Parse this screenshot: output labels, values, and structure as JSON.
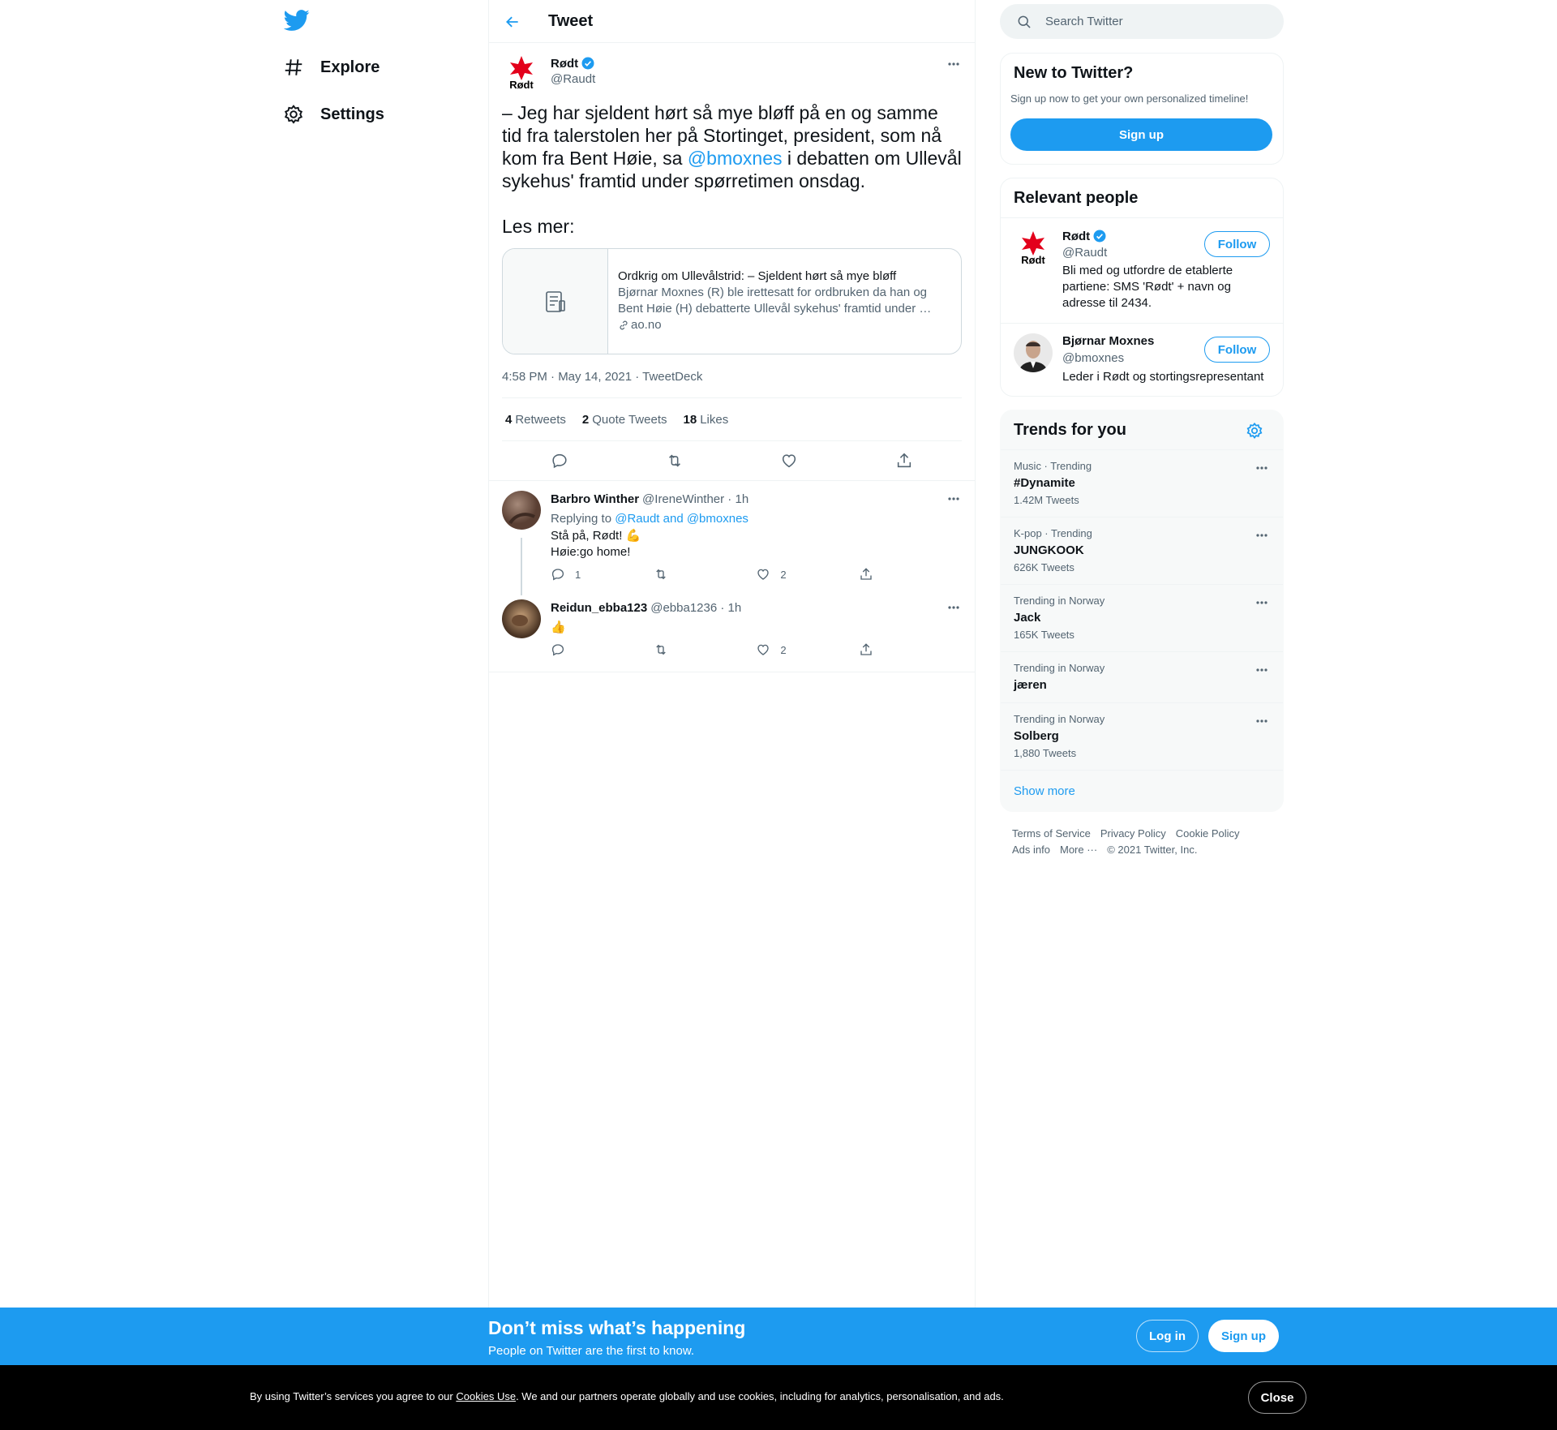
{
  "colors": {
    "accent": "#1d9bf0",
    "text": "#0f1419",
    "muted": "#536471",
    "border": "#eff3f4",
    "cookie_bg": "#000000"
  },
  "nav": {
    "logo_icon": "twitter-bird-icon",
    "items": [
      {
        "label": "Explore",
        "icon": "hashtag-icon"
      },
      {
        "label": "Settings",
        "icon": "gear-icon"
      }
    ]
  },
  "header": {
    "title": "Tweet",
    "back_icon": "arrow-left-icon"
  },
  "main_tweet": {
    "author_name": "Rødt",
    "author_handle": "@Raudt",
    "avatar_text": "Rødt",
    "text_before": "– Jeg har sjeldent hørt så mye bløff på en og samme tid fra talerstolen her på Stortinget, president, som nå kom fra Bent Høie, sa ",
    "mention": "@bmoxnes",
    "text_after": " i debatten om Ullevål sykehus' framtid under spørretimen onsdag.\n\nLes mer:",
    "card": {
      "title": "Ordkrig om Ullevålstrid: – Sjeldent hørt så mye bløff",
      "description": "Bjørnar Moxnes (R) ble irettesatt for ordbruken da han og Bent Høie (H) debatterte Ullevål sykehus' framtid under …",
      "domain": "ao.no"
    },
    "timestamp": "4:58 PM · May 14, 2021 · TweetDeck",
    "stats": [
      {
        "count": "4",
        "label": "Retweets"
      },
      {
        "count": "2",
        "label": "Quote Tweets"
      },
      {
        "count": "18",
        "label": "Likes"
      }
    ]
  },
  "replies": [
    {
      "name": "Barbro Winther",
      "handle_time": "@IreneWinther · 1h",
      "replying_label": "Replying to",
      "replying_to": "@Raudt and @bmoxnes",
      "text": "Stå på, Rødt! 💪\nHøie:go home!",
      "reply_count": "1",
      "retweet_count": "",
      "like_count": "2"
    },
    {
      "name": "Reidun_ebba123",
      "handle_time": "@ebba1236 · 1h",
      "text": "👍",
      "reply_count": "",
      "retweet_count": "",
      "like_count": "2"
    }
  ],
  "search": {
    "placeholder": "Search Twitter"
  },
  "new_to_twitter": {
    "title": "New to Twitter?",
    "subtitle": "Sign up now to get your own personalized timeline!",
    "button": "Sign up"
  },
  "relevant_people": {
    "title": "Relevant people",
    "people": [
      {
        "name": "Rødt",
        "handle": "@Raudt",
        "bio": "Bli med og utfordre de etablerte partiene: SMS 'Rødt' + navn og adresse til 2434.",
        "button": "Follow",
        "verified": true
      },
      {
        "name": "Bjørnar Moxnes",
        "handle": "@bmoxnes",
        "bio": "Leder i Rødt og stortingsrepresentant",
        "button": "Follow",
        "verified": false
      }
    ]
  },
  "trends": {
    "title": "Trends for you",
    "items": [
      {
        "meta": "Music · Trending",
        "name": "#Dynamite",
        "count": "1.42M Tweets"
      },
      {
        "meta": "K-pop · Trending",
        "name": "JUNGKOOK",
        "count": "626K Tweets"
      },
      {
        "meta": "Trending in Norway",
        "name": "Jack",
        "count": "165K Tweets"
      },
      {
        "meta": "Trending in Norway",
        "name": "jæren",
        "count": ""
      },
      {
        "meta": "Trending in Norway",
        "name": "Solberg",
        "count": "1,880 Tweets"
      }
    ],
    "show_more": "Show more"
  },
  "footer": {
    "links": [
      "Terms of Service",
      "Privacy Policy",
      "Cookie Policy",
      "Ads info",
      "More ···",
      "© 2021 Twitter, Inc."
    ]
  },
  "signup_bar": {
    "title": "Don’t miss what’s happening",
    "subtitle": "People on Twitter are the first to know.",
    "login": "Log in",
    "signup": "Sign up"
  },
  "cookie_bar": {
    "text_before": "By using Twitter’s services you agree to our ",
    "link": "Cookies Use",
    "text_after": ". We and our partners operate globally and use cookies, including for analytics, personalisation, and ads.",
    "close": "Close"
  }
}
